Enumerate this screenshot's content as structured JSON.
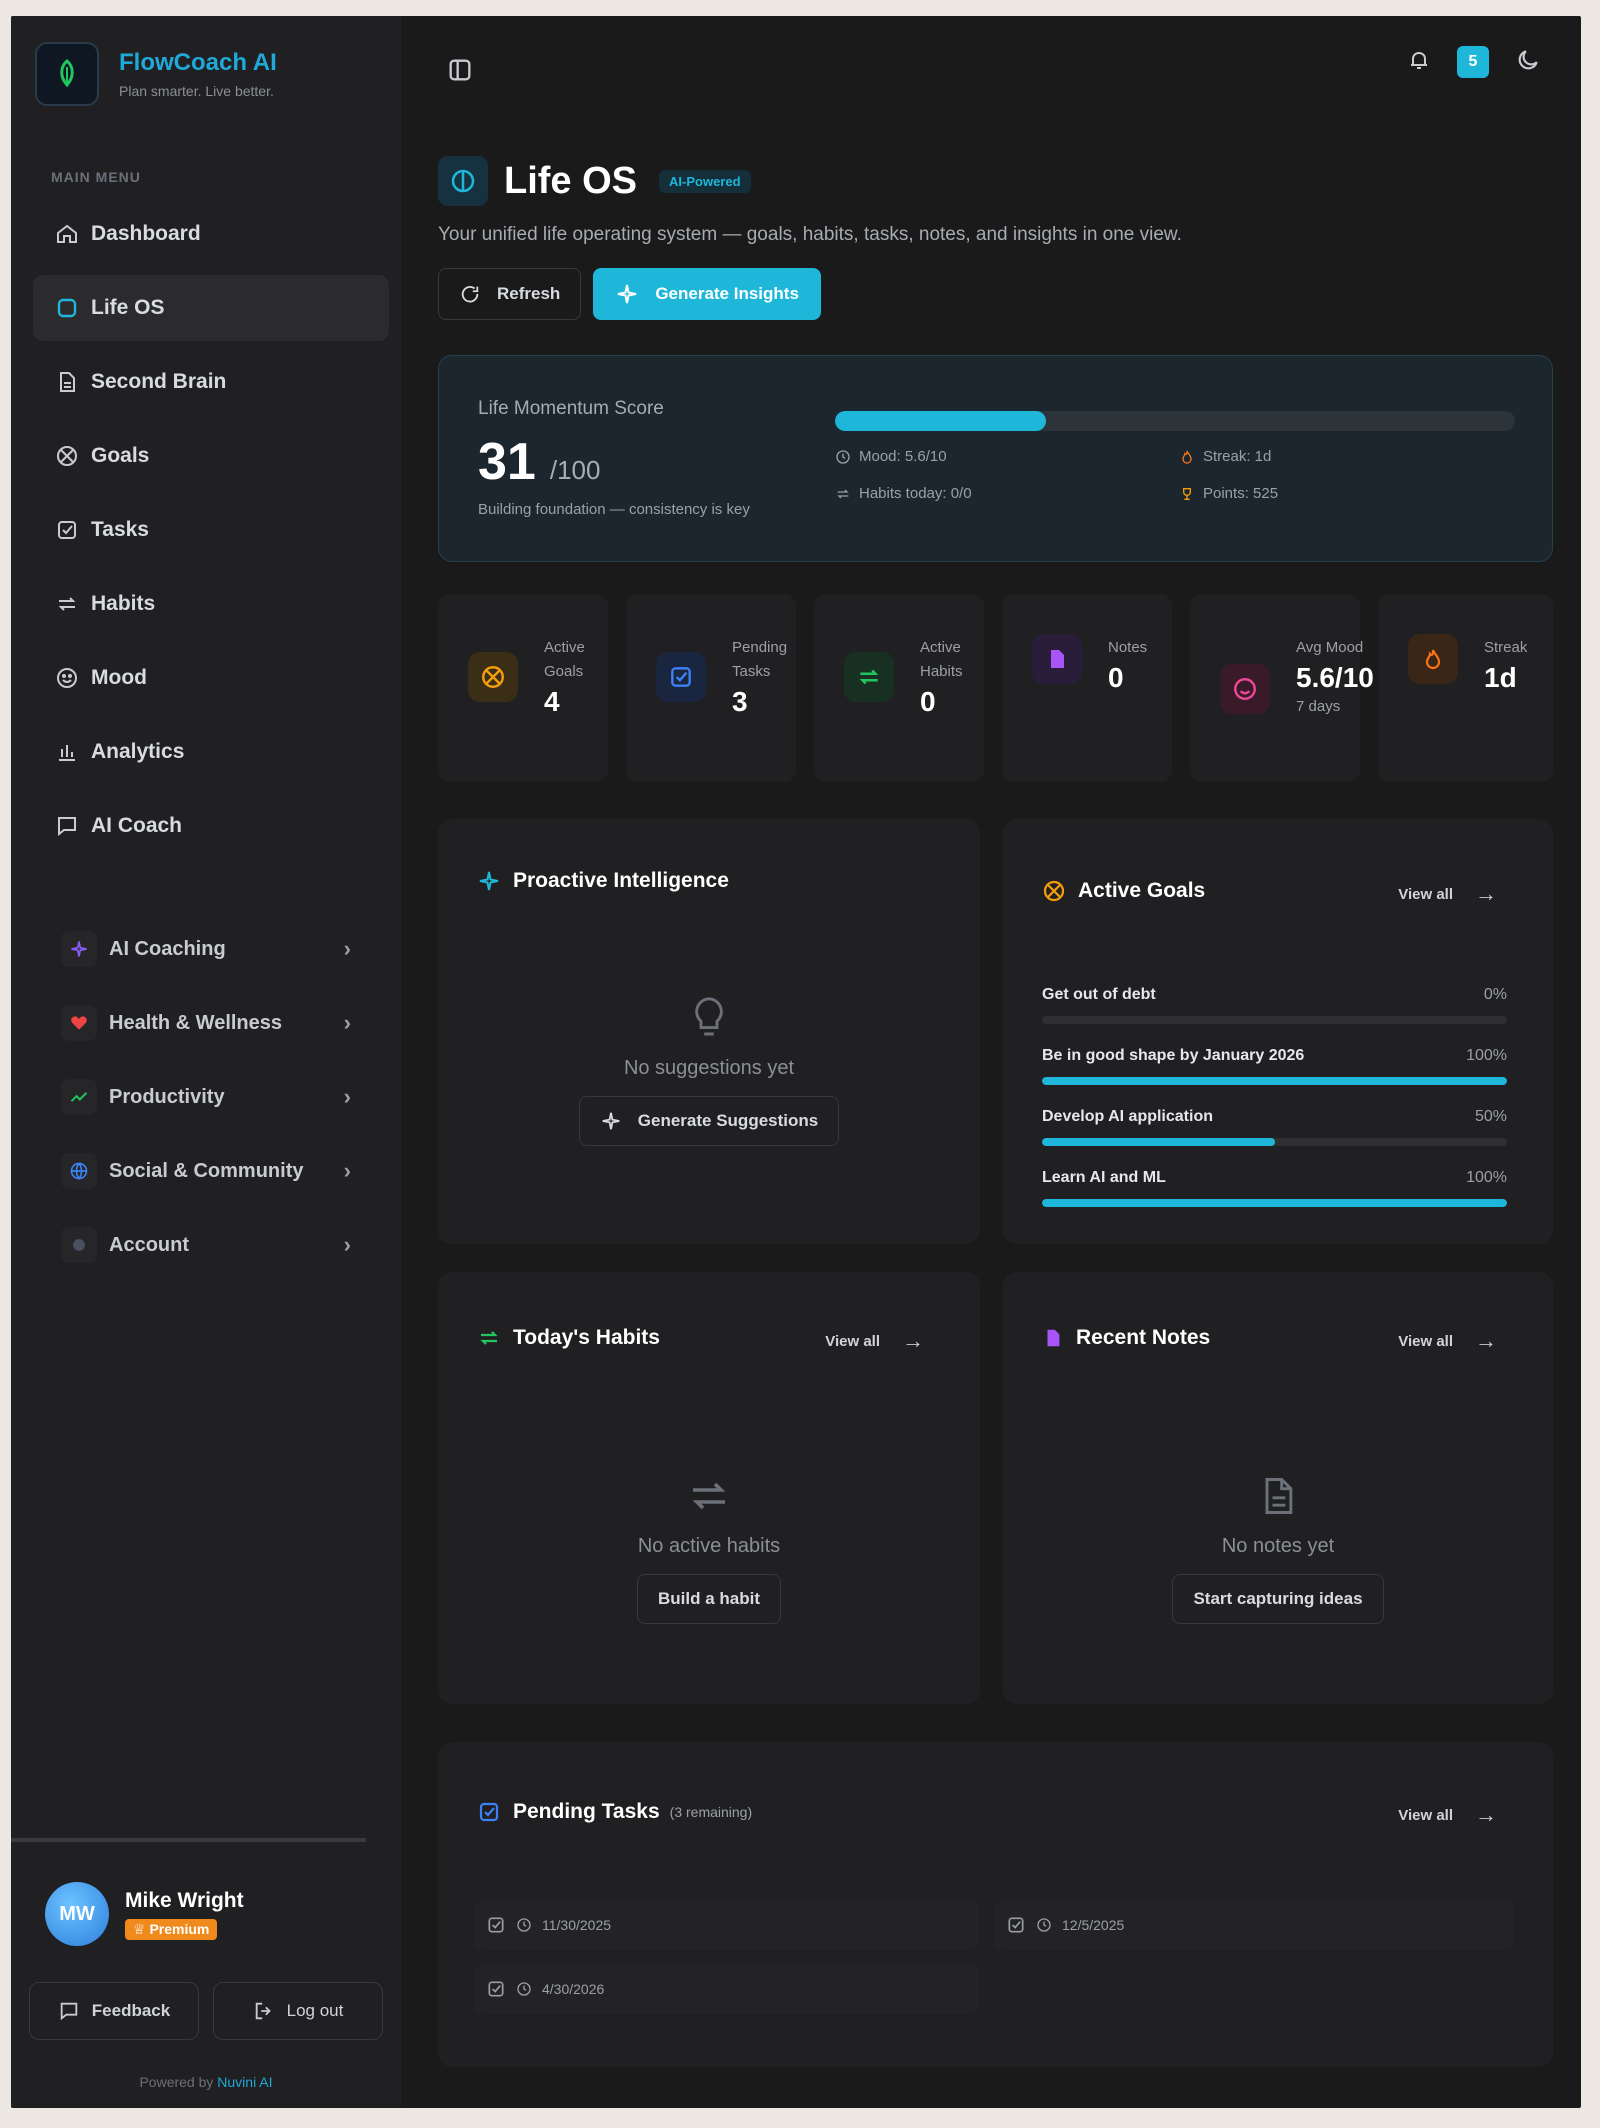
{
  "app": {
    "name": "FlowCoach AI",
    "tagline": "Plan smarter. Live better."
  },
  "sidebar": {
    "menu_label": "MAIN MENU",
    "items": [
      {
        "label": "Dashboard",
        "icon": "home-icon"
      },
      {
        "label": "Life OS",
        "icon": "life-os-icon",
        "active": true
      },
      {
        "label": "Second Brain",
        "icon": "document-icon"
      },
      {
        "label": "Goals",
        "icon": "target-icon"
      },
      {
        "label": "Tasks",
        "icon": "checkbox-icon"
      },
      {
        "label": "Habits",
        "icon": "repeat-icon"
      },
      {
        "label": "Mood",
        "icon": "smile-icon"
      },
      {
        "label": "Analytics",
        "icon": "bar-chart-icon"
      },
      {
        "label": "AI Coach",
        "icon": "chat-icon"
      }
    ],
    "groups": [
      {
        "label": "AI Coaching",
        "icon": "sparkle-icon",
        "color": "#8b5cf6"
      },
      {
        "label": "Health & Wellness",
        "icon": "heart-icon",
        "color": "#ef4444"
      },
      {
        "label": "Productivity",
        "icon": "trending-icon",
        "color": "#22c55e"
      },
      {
        "label": "Social & Community",
        "icon": "globe-icon",
        "color": "#3b82f6"
      },
      {
        "label": "Account",
        "icon": "gear-icon",
        "color": "#6b7280"
      }
    ],
    "user": {
      "initials": "MW",
      "name": "Mike Wright",
      "badge": "Premium"
    },
    "feedback_label": "Feedback",
    "logout_label": "Log out",
    "powered_prefix": "Powered by",
    "powered_brand": "Nuvini AI"
  },
  "topbar": {
    "notification_count": "5"
  },
  "header": {
    "title": "Life OS",
    "badge": "AI-Powered",
    "subtitle": "Your unified life operating system — goals, habits, tasks, notes, and insights in one view.",
    "refresh_label": "Refresh",
    "generate_label": "Generate Insights"
  },
  "momentum": {
    "label": "Life Momentum Score",
    "score": "31",
    "max": "/100",
    "note": "Building foundation — consistency is key",
    "progress": 0.31,
    "mood": "Mood: 5.6/10",
    "habits_today": "Habits today: 0/0",
    "streak": "Streak: 1d",
    "points": "Points: 525"
  },
  "stats": [
    {
      "label": "Active Goals",
      "value": "4",
      "icon": "target-icon",
      "color": "#f59e0b",
      "bg": "#3a2e17"
    },
    {
      "label": "Pending Tasks",
      "value": "3",
      "icon": "checkbox-icon",
      "color": "#3b82f6",
      "bg": "#1a2540"
    },
    {
      "label": "Active Habits",
      "value": "0",
      "icon": "repeat-icon",
      "color": "#22c55e",
      "bg": "#183022"
    },
    {
      "label": "Notes",
      "value": "0",
      "icon": "note-icon",
      "color": "#a855f7",
      "bg": "#2a1d3a"
    },
    {
      "label": "Avg Mood",
      "value": "5.6/10",
      "sub": "7 days",
      "icon": "smile-icon",
      "color": "#ec4899",
      "bg": "#3a1a28"
    },
    {
      "label": "Streak",
      "value": "1d",
      "icon": "flame-icon",
      "color": "#f97316",
      "bg": "#3a2617"
    }
  ],
  "proactive": {
    "title": "Proactive Intelligence",
    "empty": "No suggestions yet",
    "button": "Generate Suggestions"
  },
  "goals_panel": {
    "title": "Active Goals",
    "view_all": "View all",
    "goals": [
      {
        "name": "Get out of debt",
        "percent_label": "0%",
        "progress": 0
      },
      {
        "name": "Be in good shape by January 2026",
        "percent_label": "100%",
        "progress": 1
      },
      {
        "name": "Develop AI application",
        "percent_label": "50%",
        "progress": 0.5
      },
      {
        "name": "Learn AI and ML",
        "percent_label": "100%",
        "progress": 1
      }
    ]
  },
  "habits_panel": {
    "title": "Today's Habits",
    "view_all": "View all",
    "empty": "No active habits",
    "button": "Build a habit"
  },
  "notes_panel": {
    "title": "Recent Notes",
    "view_all": "View all",
    "empty": "No notes yet",
    "button": "Start capturing ideas"
  },
  "tasks_panel": {
    "title": "Pending Tasks",
    "remaining": "(3 remaining)",
    "view_all": "View all",
    "tasks": [
      {
        "date": "11/30/2025"
      },
      {
        "date": "12/5/2025"
      },
      {
        "date": "4/30/2026"
      }
    ]
  }
}
